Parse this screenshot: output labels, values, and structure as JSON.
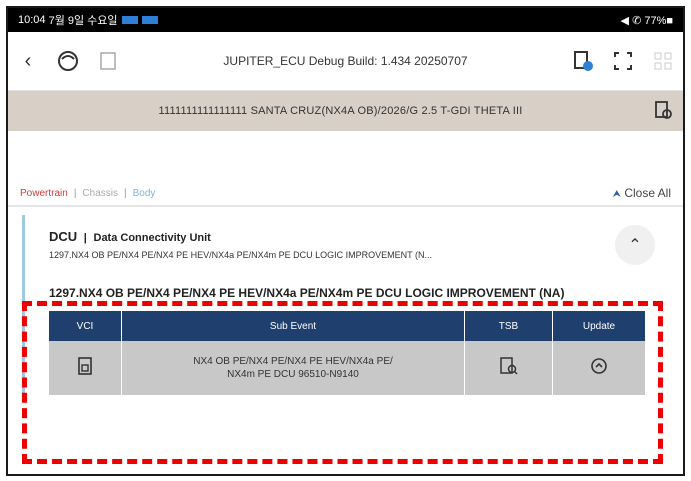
{
  "status_bar": {
    "time": "10:04",
    "date": "7월 9일 수요일",
    "right": "◀ ✆ 77%■"
  },
  "toolbar": {
    "back": "‹",
    "title": "JUPITER_ECU Debug Build: 1.434 20250707"
  },
  "vehicle": {
    "info": "1111111111111111 SANTA CRUZ(NX4A OB)/2026/G 2.5 T-GDI THETA III"
  },
  "tabs": {
    "powertrain": "Powertrain",
    "chassis": "Chassis",
    "body": "Body",
    "separator": "|",
    "close_all": "Close All"
  },
  "unit": {
    "code": "DCU",
    "separator": "|",
    "name": "Data Connectivity Unit",
    "description": "1297.NX4 OB PE/NX4 PE/NX4 PE HEV/NX4a PE/NX4m PE DCU LOGIC IMPROVEMENT (N..."
  },
  "event": {
    "title": "1297.NX4 OB PE/NX4 PE/NX4 PE HEV/NX4a PE/NX4m PE DCU LOGIC IMPROVEMENT (NA)",
    "columns": [
      "VCI",
      "Sub Event",
      "TSB",
      "Update"
    ],
    "row": {
      "sub_event_line1": "NX4 OB PE/NX4 PE/NX4 PE HEV/NX4a PE/",
      "sub_event_line2": "NX4m PE DCU 96510-N9140"
    }
  }
}
